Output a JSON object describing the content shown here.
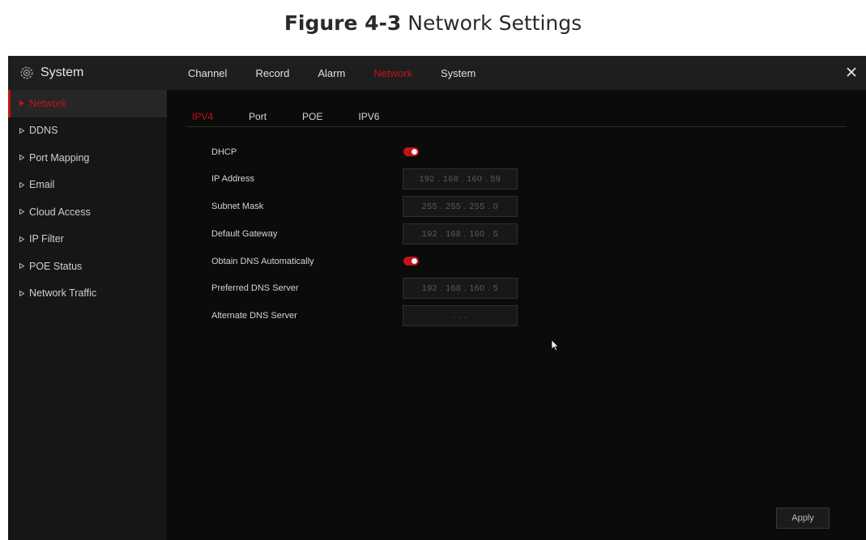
{
  "caption": {
    "bold": "Figure 4-3",
    "text": "Network Settings"
  },
  "header": {
    "title": "System",
    "icon": "gear-icon",
    "menu": [
      {
        "label": "Channel",
        "active": false
      },
      {
        "label": "Record",
        "active": false
      },
      {
        "label": "Alarm",
        "active": false
      },
      {
        "label": "Network",
        "active": true
      },
      {
        "label": "System",
        "active": false
      }
    ],
    "close_icon": "close-icon"
  },
  "sidebar": {
    "items": [
      {
        "label": "Network",
        "active": true
      },
      {
        "label": "DDNS",
        "active": false
      },
      {
        "label": "Port Mapping",
        "active": false
      },
      {
        "label": "Email",
        "active": false
      },
      {
        "label": "Cloud Access",
        "active": false
      },
      {
        "label": "IP Filter",
        "active": false
      },
      {
        "label": "POE Status",
        "active": false
      },
      {
        "label": "Network Traffic",
        "active": false
      }
    ]
  },
  "tabs": [
    {
      "label": "IPV4",
      "active": true
    },
    {
      "label": "Port",
      "active": false
    },
    {
      "label": "POE",
      "active": false
    },
    {
      "label": "IPV6",
      "active": false
    }
  ],
  "form": {
    "dhcp": {
      "label": "DHCP",
      "enabled": true
    },
    "ip_address": {
      "label": "IP Address",
      "value": "192 . 168 . 160 . 59"
    },
    "subnet_mask": {
      "label": "Subnet Mask",
      "value": "255 . 255 . 255 . 0"
    },
    "default_gateway": {
      "label": "Default Gateway",
      "value": "192 . 168 . 160 . 5"
    },
    "obtain_dns": {
      "label": "Obtain DNS Automatically",
      "enabled": true
    },
    "preferred_dns": {
      "label": "Preferred DNS Server",
      "value": "192 . 168 . 160 . 5"
    },
    "alternate_dns": {
      "label": "Alternate DNS Server",
      "value": ".      .      ."
    }
  },
  "apply_label": "Apply",
  "colors": {
    "accent": "#c4121a",
    "background": "#0b0b0b",
    "sidebar": "#161616",
    "topbar": "#1e1e1e"
  }
}
